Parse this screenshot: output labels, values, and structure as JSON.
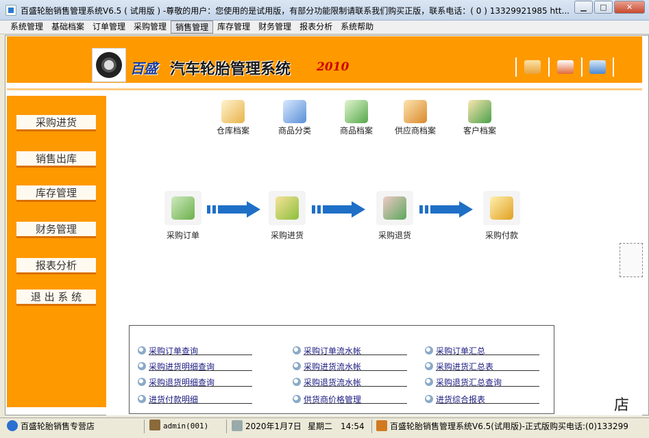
{
  "window": {
    "title": "百盛轮胎销售管理系统V6.5 ( 试用版 ) -尊敬的用户：您使用的是试用版，有部分功能限制请联系我们购买正版，联系电话：( 0 ) 13329921985  htt...",
    "minimize": "▁",
    "maximize": "□",
    "close": "✕"
  },
  "menu": [
    "系统管理",
    "基础档案",
    "订单管理",
    "采购管理",
    "销售管理",
    "库存管理",
    "财务管理",
    "报表分析",
    "系统帮助"
  ],
  "banner": {
    "brand": "百盛",
    "system_name": "汽车轮胎管理系统",
    "year": "2010"
  },
  "sidebar": [
    "采购进货",
    "销售出库",
    "库存管理",
    "财务管理",
    "报表分析",
    "退 出 系 统"
  ],
  "top_icons": [
    {
      "label": "仓库档案",
      "icon": "warehouse-icon",
      "color": "#e8b34a"
    },
    {
      "label": "商品分类",
      "icon": "category-icon",
      "color": "#5a8fd6"
    },
    {
      "label": "商品档案",
      "icon": "product-icon",
      "color": "#56a84a"
    },
    {
      "label": "供应商档案",
      "icon": "supplier-icon",
      "color": "#d98a2b"
    },
    {
      "label": "客户档案",
      "icon": "customer-icon",
      "color": "#4aa04a"
    }
  ],
  "flow": [
    {
      "label": "采购订单",
      "icon": "purchase-order-icon",
      "color": "#6bb04a"
    },
    {
      "label": "采购进货",
      "icon": "purchase-in-icon",
      "color": "#8bbf3a"
    },
    {
      "label": "采购退货",
      "icon": "purchase-return-icon",
      "color": "#5aa85a"
    },
    {
      "label": "采购付款",
      "icon": "payment-icon",
      "color": "#e0a020"
    }
  ],
  "links": [
    [
      "采购订单查询",
      "采购订单流水帐",
      "采购订单汇总"
    ],
    [
      "采购进货明细查询",
      "采购进货流水帐",
      "采购进货汇总表"
    ],
    [
      "采购退货明细查询",
      "采购退货流水帐",
      "采购退货汇总查询"
    ],
    [
      "进货付款明细",
      "供货商价格管理",
      "进货综合报表"
    ]
  ],
  "shop_char": "店",
  "statusbar": {
    "shop": "百盛轮胎销售专营店",
    "user": "admin(001)",
    "date": "2020年1月7日",
    "weekday": "星期二",
    "time": "14:54",
    "info": "百盛轮胎销售管理系统V6.5(试用版)-正式版购买电话:(0)133299"
  },
  "colors": {
    "accent": "#ff9900",
    "arrow": "#1f6fc7"
  }
}
